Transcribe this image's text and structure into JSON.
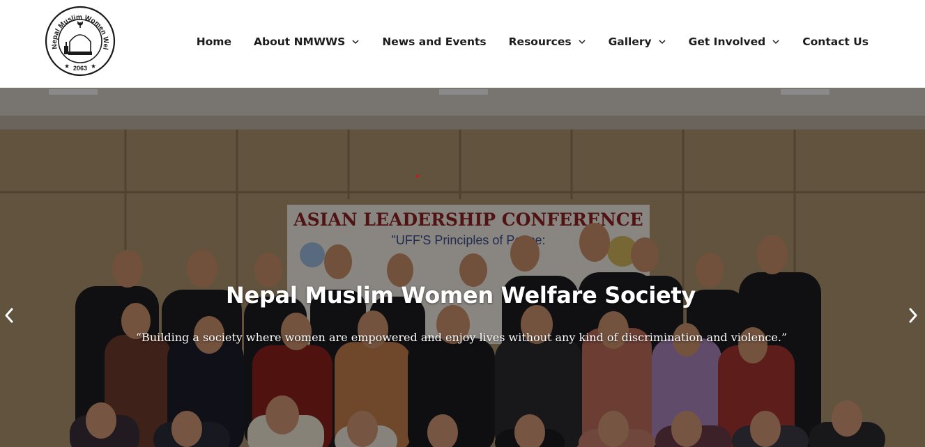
{
  "logo": {
    "ring_text": "Nepal Muslim Women Welfare Society",
    "year": "2063",
    "icon": "mosque-emblem-icon"
  },
  "nav": {
    "items": [
      {
        "label": "Home",
        "has_dropdown": false
      },
      {
        "label": "About NMWWS",
        "has_dropdown": true
      },
      {
        "label": "News and Events",
        "has_dropdown": false
      },
      {
        "label": "Resources",
        "has_dropdown": true
      },
      {
        "label": "Gallery",
        "has_dropdown": true
      },
      {
        "label": "Get Involved",
        "has_dropdown": true
      },
      {
        "label": "Contact Us",
        "has_dropdown": false
      }
    ]
  },
  "hero": {
    "title": "Nepal Muslim Women Welfare Society",
    "subtitle": "“Building a society where women are empowered and enjoy lives without any kind of discrimination and violence.”",
    "banner_title": "ASIAN LEADERSHIP CONFERENCE",
    "banner_subtitle": "\"UFF'S Principles of Peace:",
    "prev_icon": "chevron-left-icon",
    "next_icon": "chevron-right-icon"
  },
  "colors": {
    "nav_text": "#1c1c1c",
    "hero_text": "#ffffff",
    "banner_title": "#8a1f1f"
  }
}
